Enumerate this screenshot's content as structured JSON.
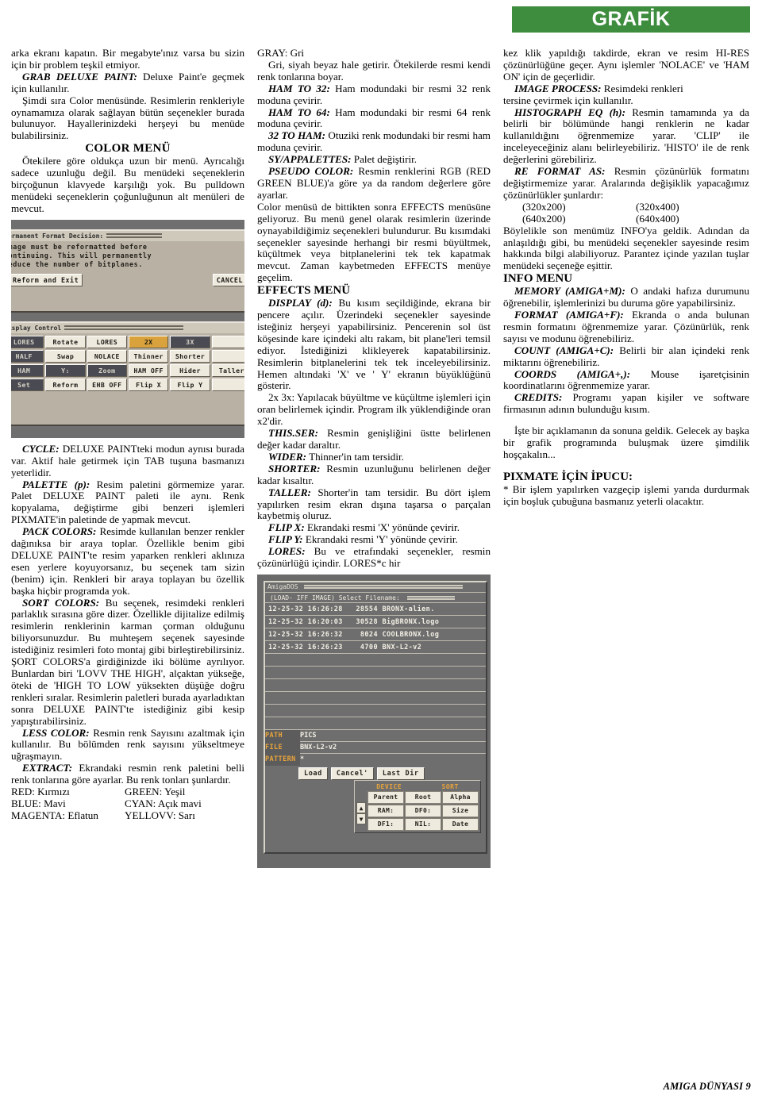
{
  "header": {
    "title": "GRAFİK"
  },
  "footer": {
    "text": "AMIGA DÜNYASI 9"
  },
  "column1": {
    "p1": "arka ekranı kapatın. Bir megabyte'ınız varsa bu sizin için bir problem teşkil etmiyor.",
    "p2_head": "GRAB DELUXE PAINT:",
    "p2": " Deluxe Paint'e geçmek için kullanılır.",
    "p3": "Şimdi sıra Color menüsünde. Resimlerin renkleriyle oynamamıza olarak sağlayan bütün seçenekler burada bulunuyor. Hayallerinizdeki herşeyi bu menüde bulabilirsiniz.",
    "h1": "COLOR MENÜ",
    "p4": "Ötekilere göre oldukça uzun bir menü. Ayrıcalığı sadece uzunluğu değil. Bu menüdeki seçeneklerin birçoğunun klavyede karşılığı yok. Bu pulldown menüdeki seçeneklerin çoğunluğunun alt menüleri de mevcut.",
    "p5_head": "CYCLE:",
    "p5": " DELUXE PAINTteki modun aynısı burada var. Aktif hale getirmek için TAB tuşuna basmanızı yeterlidir.",
    "p6_head": "PALETTE (p):",
    "p6": " Resim paletini görmemize yarar. Palet DELUXE PAINT paleti ile aynı. Renk kopyalama, değiştirme gibi benzeri işlemleri PIXMATE'in paletinde de yapmak mevcut.",
    "p7_head": "PACK COLORS:",
    "p7": " Resimde kullanılan benzer renkler dağınıksa bir araya toplar. Özellikle benim gibi DELUXE PAINT'te resim yaparken renkleri aklınıza esen yerlere koyuyorsanız, bu seçenek tam sizin (benim) için. Renkleri bir araya toplayan bu özellik başka hiçbir programda yok.",
    "p8_head": "SORT COLORS:",
    "p8": " Bu seçenek, resimdeki renkleri parlaklık sırasına göre dizer. Özellikle dijitalize edilmiş resimlerin renklerinin karman çorman olduğunu biliyorsunuzdur. Bu muhteşem seçenek sayesinde istediğiniz resimleri foto montaj gibi birleştirebilirsiniz. ŞORT COLORS'a girdiğinizde iki bölüme ayrılıyor. Bunlardan biri 'LOVV THE HIGH', alçaktan yükseğe, öteki de 'HIGH TO LOW yüksekten düşüğe doğru renkleri sıralar. Resimlerin paletleri burada ayarladıktan sonra DELUXE PAINT'te istediğiniz gibi kesip yapıştırabilirsiniz.",
    "p9_head": "LESS COLOR:",
    "p9": " Resmin renk Sayısını azaltmak için kullanılır. Bu bölümden renk sayısını yükseltmeye uğraşmayın.",
    "p10_head": "EXTRACT:",
    "p10": " Ekrandaki resmin renk paletini belli renk tonlarına göre ayarlar. Bu renk tonları şunlardır.",
    "colors": [
      {
        "left": "RED: Kırmızı",
        "right": "GREEN: Yeşil"
      },
      {
        "left": "BLUE: Mavi",
        "right": "CYAN: Açık mavi"
      },
      {
        "left": "MAGENTA: Eflatun",
        "right": "YELLOVV: Sarı"
      }
    ]
  },
  "column2": {
    "p0": "GRAY: Gri",
    "p1": "Gri, siyah beyaz hale getirir. Ötekilerde resmi kendi renk tonlarına boyar.",
    "p2_head": "HAM TO 32:",
    "p2": " Ham modundaki bir resmi 32 renk moduna çevirir.",
    "p3_head": "HAM TO 64:",
    "p3": " Ham modundaki bir resmi 64 renk moduna çevirir.",
    "p4_head": "32 TO HAM:",
    "p4": " Otuziki renk modundaki bir resmi ham moduna çevirir.",
    "p5_head": "SY/APPALETTES:",
    "p5": " Palet değiştirir.",
    "p6_head": "PSEUDO COLOR:",
    "p6": " Resmin renklerini RGB (RED GREEN BLUE)'a göre ya da random değerlere göre ayarlar.",
    "p7": "Color menüsü de bittikten sonra EFFECTS menüsüne geliyoruz. Bu menü genel olarak resimlerin üzerinde oynayabildiğimiz seçenekleri bulundurur. Bu kısımdaki seçenekler sayesinde herhangi bir resmi büyültmek, küçültmek veya bitplanelerini tek tek kapatmak mevcut. Zaman kaybetmeden EFFECTS menüye geçelim.",
    "h1": "EFFECTS MENÜ",
    "p8_head": "DISPLAY (d):",
    "p8": " Bu kısım seçildiğinde, ekrana bir pencere açılır. Üzerindeki seçenekler sayesinde isteğiniz herşeyi yapabilirsiniz. Pencerenin sol üst köşesinde kare içindeki altı rakam, bit plane'leri temsil ediyor. İstediğinizi klikleyerek kapatabilirsiniz. Resimlerin bitplanelerini tek tek inceleyebilirsiniz. Hemen altındaki 'X' ve ' Y' ekranın büyüklüğünü gösterir.",
    "p9": "2x 3x: Yapılacak büyültme ve küçültme işlemleri için oran belirlemek içindir. Program ilk yüklendiğinde oran x2'dir.",
    "p10_head": "THIS.SER:",
    "p10": " Resmin genişliğini üstte belirlenen değer kadar daraltır.",
    "p11_head": "WIDER:",
    "p11": " Thinner'in tam tersidir.",
    "p12_head": "SHORTER:",
    "p12": " Resmin uzunluğunu belirlenen değer kadar kısaltır.",
    "p13_head": "TALLER:",
    "p13": " Shorter'in tam tersidir. Bu dört işlem yapılırken resim ekran dışına taşarsa o parçalan kaybetmiş oluruz.",
    "p14_head": "FLIP X:",
    "p14": " Ekrandaki resmi 'X' yönünde çevirir.",
    "p15_head": "FLIP Y:",
    "p15": " Ekrandaki resmi 'Y' yönünde çevirir.",
    "p16_head": "LORES:",
    "p16": " Bu ve etrafındaki seçenekler, resmin çözünürlüğü içindir. LORES*c hir"
  },
  "column3": {
    "p1": "kez klik yapıldığı takdirde, ekran ve resim HI-RES çözünürlüğüne geçer. Aynı işlemler 'NOLACE' ve 'HAM ON' için de geçerlidir.",
    "p2_head": "IMAGE        PROCESS:",
    "p2": "  Resimdeki renkleri",
    "p2b": "tersine çevirmek için kullanılır.",
    "p3_head": "HISTOGRAPH EQ (h):",
    "p3": " Resmin tamamında ya da belirli bir bölümünde hangi renklerin ne kadar kullanıldığını öğrenmemize yarar. 'CLIP' ile inceleyeceğiniz alanı belirleyebiliriz. 'HISTO' ile de renk değerlerini görebiliriz.",
    "p4_head": "RE FORMAT AS:",
    "p4": " Resmin çözünürlük formatını değiştirmemize yarar. Aralarında değişiklik yapacağımız çözünürlükler şunlardır:",
    "res": [
      {
        "left": "(320x200)",
        "right": "(320x400)"
      },
      {
        "left": "(640x200)",
        "right": "(640x400)"
      }
    ],
    "p5": "Böylelikle son menümüz INFO'ya geldik. Adından da anlaşıldığı gibi, bu menüdeki seçenekler sayesinde resim hakkında bilgi alabiliyoruz. Parantez içinde yazılan tuşlar menüdeki seçeneğe eşittir.",
    "h1": "INFO MENU",
    "p6_head": "MEMORY (AMIGA+M):",
    "p6": " O andaki hafıza durumunu öğrenebilir, işlemlerinizi bu duruma göre yapabilirsiniz.",
    "p7_head": "FORMAT (AMIGA+F):",
    "p7": " Ekranda o anda bulunan resmin formatını öğrenmemize yarar. Çözünürlük, renk sayısı ve modunu öğrenebiliriz.",
    "p8_head": "COUNT (AMIGA+C):",
    "p8": " Belirli bir alan içindeki renk miktarını öğrenebiliriz.",
    "p9_head": "COORDS (AMIGA+,):",
    "p9": " Mouse işaretçisinin koordinatlarını öğrenmemize yarar.",
    "p10_head": "CREDITS:",
    "p10": " Programı yapan kişiler ve software firmasının adının bulunduğu kısım.",
    "p11": "İşte bir açıklamanın da sonuna geldik. Gelecek ay başka bir grafik programında buluşmak üzere şimdilik hoşçakalın...",
    "h2": "PIXMATE İÇİN İPUCU:",
    "p12": "* Bir işlem yapılırken vazgeçip işlemi yarıda durdurmak için boşluk çubuğuna basmanız yeterli olacaktır."
  },
  "shot1": {
    "dialog": {
      "title": "Permanent Format Decision:",
      "line1": "Image must be reformatted before",
      "line2": "continuing.  This will permanently",
      "line3": "reduce the number of bitplanes.",
      "btn_ok": "Reform and Exit",
      "btn_cancel": "CANCEL"
    },
    "panel": {
      "title": "Display Control",
      "buttons": [
        [
          "LORES",
          "Rotate",
          "LORES",
          "2X",
          "3X",
          ""
        ],
        [
          "HALF",
          "Swap",
          "NOLACE",
          "Thinner",
          "Shorter",
          ""
        ],
        [
          "HAM",
          "Y:",
          "Zoom",
          "HAM OFF",
          "Hider",
          "Taller"
        ],
        [
          "Set",
          "Reform",
          "EHB OFF",
          "Flip X",
          "Flip Y",
          ""
        ]
      ]
    }
  },
  "shot2": {
    "titlebar": "AmigaDOS",
    "subtitle": "(LOAD- IFF IMAGE) Select Filename:",
    "files": [
      {
        "date": "12-25-32",
        "time": "16:26:28",
        "size": "28554",
        "name": "BRONX-alien."
      },
      {
        "date": "12-25-32",
        "time": "16:20:03",
        "size": "30528",
        "name": "BigBRONX.logo"
      },
      {
        "date": "12-25-32",
        "time": "16:26:32",
        "size": "8024",
        "name": "COOLBRONX.log"
      },
      {
        "date": "12-25-32",
        "time": "16:26:23",
        "size": "4700",
        "name": "BNX-L2-v2"
      }
    ],
    "fields": [
      {
        "label": "PATH",
        "value": "PICS"
      },
      {
        "label": "FILE",
        "value": "BNX-L2-v2"
      },
      {
        "label": "PATTERN",
        "value": "*"
      }
    ],
    "buttons": [
      "Load",
      "Cancel'",
      "Last Dir"
    ],
    "device_header": "DEVICE",
    "sort_header": "SORT",
    "device_rows": [
      [
        "Parent",
        "Root",
        "Alpha"
      ],
      [
        "RAM:",
        "DF0:",
        "Size"
      ],
      [
        "DF1:",
        "NIL:",
        "Date"
      ]
    ],
    "arrow_up": "▲",
    "arrow_down": "▼"
  }
}
